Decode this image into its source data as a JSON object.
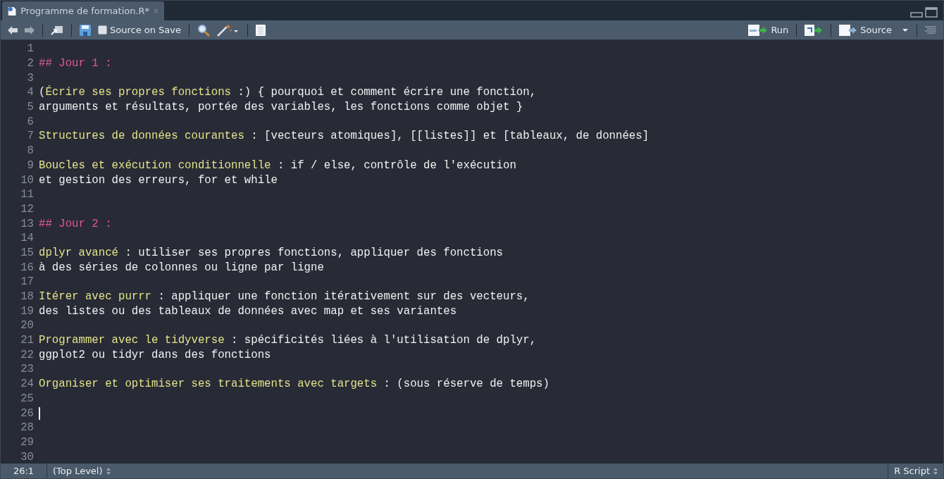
{
  "tab": {
    "title": "Programme de formation.R*"
  },
  "toolbar": {
    "source_on_save": {
      "label": "Source on Save",
      "checked": false
    },
    "run_label": "Run",
    "source_label": "Source"
  },
  "editor": {
    "lines": [
      {
        "number": "1",
        "cursor": false
      },
      {
        "number": "2",
        "cursor": false,
        "segments": [
          {
            "kind": "heading",
            "text": "## Jour 1 :"
          }
        ]
      },
      {
        "number": "3",
        "cursor": false
      },
      {
        "number": "4",
        "cursor": false,
        "segments": [
          {
            "kind": "text",
            "text": "("
          },
          {
            "kind": "label",
            "text": "Écrire ses propres fonctions"
          },
          {
            "kind": "text",
            "text": " :) { pourquoi et comment écrire une fonction,"
          }
        ]
      },
      {
        "number": "5",
        "cursor": false,
        "segments": [
          {
            "kind": "text",
            "text": "arguments et résultats, portée des variables, les fonctions comme objet }"
          }
        ]
      },
      {
        "number": "6",
        "cursor": false
      },
      {
        "number": "7",
        "cursor": false,
        "segments": [
          {
            "kind": "label",
            "text": "Structures de données courantes"
          },
          {
            "kind": "text",
            "text": " : [vecteurs atomiques], [[listes]] et [tableaux, de données]"
          }
        ]
      },
      {
        "number": "8",
        "cursor": false
      },
      {
        "number": "9",
        "cursor": false,
        "segments": [
          {
            "kind": "label",
            "text": "Boucles et exécution conditionnelle"
          },
          {
            "kind": "text",
            "text": " : if / else, contrôle de l'exécution"
          }
        ]
      },
      {
        "number": "10",
        "cursor": false,
        "segments": [
          {
            "kind": "text",
            "text": "et gestion des erreurs, for et while"
          }
        ]
      },
      {
        "number": "11",
        "cursor": false
      },
      {
        "number": "12",
        "cursor": false
      },
      {
        "number": "13",
        "cursor": false,
        "segments": [
          {
            "kind": "heading",
            "text": "## Jour 2 :"
          }
        ]
      },
      {
        "number": "14",
        "cursor": false
      },
      {
        "number": "15",
        "cursor": false,
        "segments": [
          {
            "kind": "label",
            "text": "dplyr avancé"
          },
          {
            "kind": "text",
            "text": " : utiliser ses propres fonctions, appliquer des fonctions"
          }
        ]
      },
      {
        "number": "16",
        "cursor": false,
        "segments": [
          {
            "kind": "text",
            "text": "à des séries de colonnes ou ligne par ligne"
          }
        ]
      },
      {
        "number": "17",
        "cursor": false
      },
      {
        "number": "18",
        "cursor": false,
        "segments": [
          {
            "kind": "label",
            "text": "Itérer avec purrr"
          },
          {
            "kind": "text",
            "text": " : appliquer une fonction itérativement sur des vecteurs,"
          }
        ]
      },
      {
        "number": "19",
        "cursor": false,
        "segments": [
          {
            "kind": "text",
            "text": "des listes ou des tableaux de données avec map et ses variantes"
          }
        ]
      },
      {
        "number": "20",
        "cursor": false
      },
      {
        "number": "21",
        "cursor": false,
        "segments": [
          {
            "kind": "label",
            "text": "Programmer avec le tidyverse"
          },
          {
            "kind": "text",
            "text": " : spécificités liées à l'utilisation de dplyr,"
          }
        ]
      },
      {
        "number": "22",
        "cursor": false,
        "segments": [
          {
            "kind": "text",
            "text": "ggplot2 ou tidyr dans des fonctions"
          }
        ]
      },
      {
        "number": "23",
        "cursor": false
      },
      {
        "number": "24",
        "cursor": false,
        "segments": [
          {
            "kind": "label",
            "text": "Organiser et optimiser ses traitements avec targets"
          },
          {
            "kind": "text",
            "text": " : (sous réserve de temps)"
          }
        ]
      },
      {
        "number": "25",
        "cursor": false
      },
      {
        "number": "26",
        "cursor": true
      },
      {
        "number": "28",
        "cursor": false
      },
      {
        "number": "29",
        "cursor": false
      },
      {
        "number": "30",
        "cursor": false
      }
    ]
  },
  "status_bar": {
    "position": "26:1",
    "scope": "(Top Level)",
    "file_type": "R Script"
  }
}
